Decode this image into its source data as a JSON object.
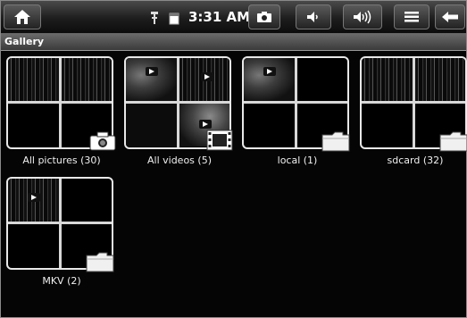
{
  "status_bar": {
    "time": "3:31 AM",
    "buttons": [
      {
        "name": "home-icon"
      },
      {
        "name": "camera-icon"
      },
      {
        "name": "volume-down-icon"
      },
      {
        "name": "volume-up-icon"
      },
      {
        "name": "menu-icon"
      },
      {
        "name": "back-icon"
      }
    ],
    "indicators": [
      "usb-icon",
      "battery-icon"
    ]
  },
  "title_bar": {
    "title": "Gallery"
  },
  "albums": [
    {
      "label": "All pictures (30)",
      "type": "pictures",
      "badge": "camera-icon"
    },
    {
      "label": "All videos (5)",
      "type": "videos",
      "badge": "film-icon"
    },
    {
      "label": "local (1)",
      "type": "folder",
      "badge": "folder-icon"
    },
    {
      "label": "sdcard (32)",
      "type": "folder",
      "badge": "folder-icon"
    },
    {
      "label": "MKV (2)",
      "type": "folder",
      "badge": "folder-icon"
    }
  ],
  "colors": {
    "background": "#050505",
    "tile_border": "#e8e8e8",
    "text": "#f0f0f0"
  }
}
